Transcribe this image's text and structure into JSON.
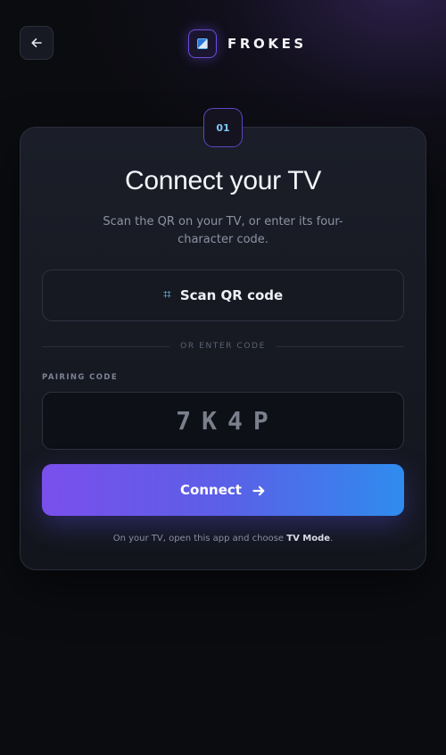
{
  "header": {
    "back_icon": "arrow-left-icon",
    "brand_name": "FROKES",
    "logo_icon": "tv-logo-icon"
  },
  "step": {
    "number": "01"
  },
  "main": {
    "title": "Connect your TV",
    "subtitle": "Scan the QR on your TV, or enter its four-character code.",
    "scan_button": {
      "icon": "hash-icon",
      "icon_glyph": "⌗",
      "label": "Scan QR code"
    },
    "divider_text": "OR ENTER CODE",
    "pairing": {
      "label": "PAIRING CODE",
      "value": "",
      "placeholder": "7K4P"
    },
    "connect_button": {
      "label": "Connect",
      "icon": "arrow-right-icon"
    },
    "footer": {
      "prefix": "On your TV, open this app and choose ",
      "emphasis": "TV Mode",
      "suffix": "."
    }
  },
  "colors": {
    "background": "#0b0c10",
    "card": "#1b1e28",
    "accent_purple": "#7a4fec",
    "accent_blue": "#2f8cee",
    "scan_icon": "#6cc3f0",
    "step_text": "#7fc6f5"
  }
}
